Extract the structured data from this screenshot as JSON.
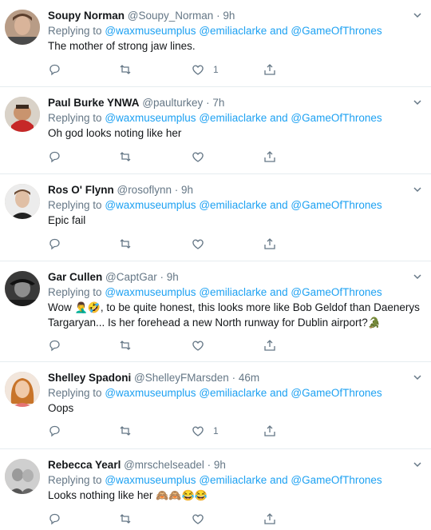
{
  "replying_label": "Replying to",
  "reply_handles": [
    "@waxmuseumplus",
    "@emiliaclarke",
    "and",
    "@GameOfThrones"
  ],
  "tweets": [
    {
      "name": "Soupy Norman",
      "handle": "@Soupy_Norman",
      "time": "9h",
      "text": "The mother of strong jaw lines.",
      "like_count": "1"
    },
    {
      "name": "Paul Burke YNWA",
      "handle": "@paulturkey",
      "time": "7h",
      "text": "Oh god looks noting like her",
      "like_count": ""
    },
    {
      "name": "Ros O' Flynn",
      "handle": "@rosoflynn",
      "time": "9h",
      "text": "Epic fail",
      "like_count": ""
    },
    {
      "name": "Gar Cullen",
      "handle": "@CaptGar",
      "time": "9h",
      "text_parts": [
        "Wow ",
        "🤦‍♂️🤣",
        ", to be quite honest, this looks more like Bob Geldof than Daenerys",
        "Targaryan... Is her forehead a new North runway for Dublin airport?",
        "🐊"
      ],
      "like_count": ""
    },
    {
      "name": "Shelley Spadoni",
      "handle": "@ShelleyFMarsden",
      "time": "46m",
      "text": "Oops",
      "like_count": "1"
    },
    {
      "name": "Rebecca Yearl",
      "handle": "@mrschelseadel",
      "time": "9h",
      "text_parts": [
        "Looks nothing like her ",
        "🙈🙈😂😂"
      ],
      "like_count": ""
    }
  ],
  "colors": {
    "link": "#1da1f2",
    "secondary": "#657786",
    "divider": "#e6ecf0"
  },
  "icons": [
    "chevron-down-icon",
    "reply-icon",
    "retweet-icon",
    "like-icon",
    "share-icon"
  ]
}
